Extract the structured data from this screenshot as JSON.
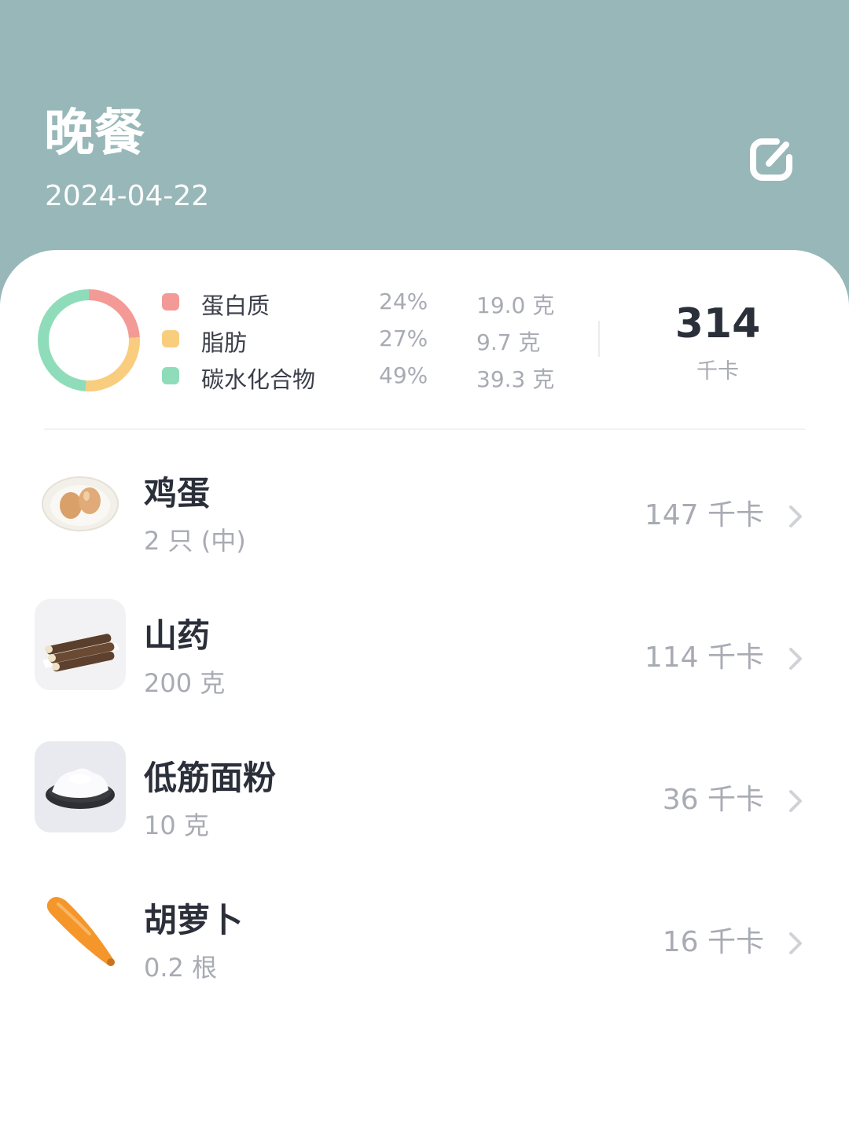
{
  "header": {
    "title": "晚餐",
    "date": "2024-04-22",
    "edit_icon": "edit-icon"
  },
  "summary": {
    "macros": [
      {
        "name": "蛋白质",
        "percent": "24%",
        "amount": "19.0 克",
        "color": "#f39a97"
      },
      {
        "name": "脂肪",
        "percent": "27%",
        "amount": "9.7 克",
        "color": "#f9cd7e"
      },
      {
        "name": "碳水化合物",
        "percent": "49%",
        "amount": "39.3 克",
        "color": "#8fdcba"
      }
    ],
    "total_kcal": "314",
    "total_unit": "千卡"
  },
  "chart_data": {
    "type": "pie",
    "categories": [
      "蛋白质",
      "脂肪",
      "碳水化合物"
    ],
    "values": [
      24,
      27,
      49
    ],
    "colors": [
      "#f39a97",
      "#f9cd7e",
      "#8fdcba"
    ]
  },
  "foods": [
    {
      "name": "鸡蛋",
      "quantity": "2 只 (中)",
      "kcal": "147 千卡",
      "thumb": "egg"
    },
    {
      "name": "山药",
      "quantity": "200 克",
      "kcal": "114 千卡",
      "thumb": "yam"
    },
    {
      "name": "低筋面粉",
      "quantity": "10 克",
      "kcal": "36 千卡",
      "thumb": "flour"
    },
    {
      "name": "胡萝卜",
      "quantity": "0.2 根",
      "kcal": "16 千卡",
      "thumb": "carrot"
    }
  ],
  "colors": {
    "header_bg": "#97b7b8",
    "text_dark": "#2b2f3a",
    "text_muted": "#a8abb3"
  }
}
